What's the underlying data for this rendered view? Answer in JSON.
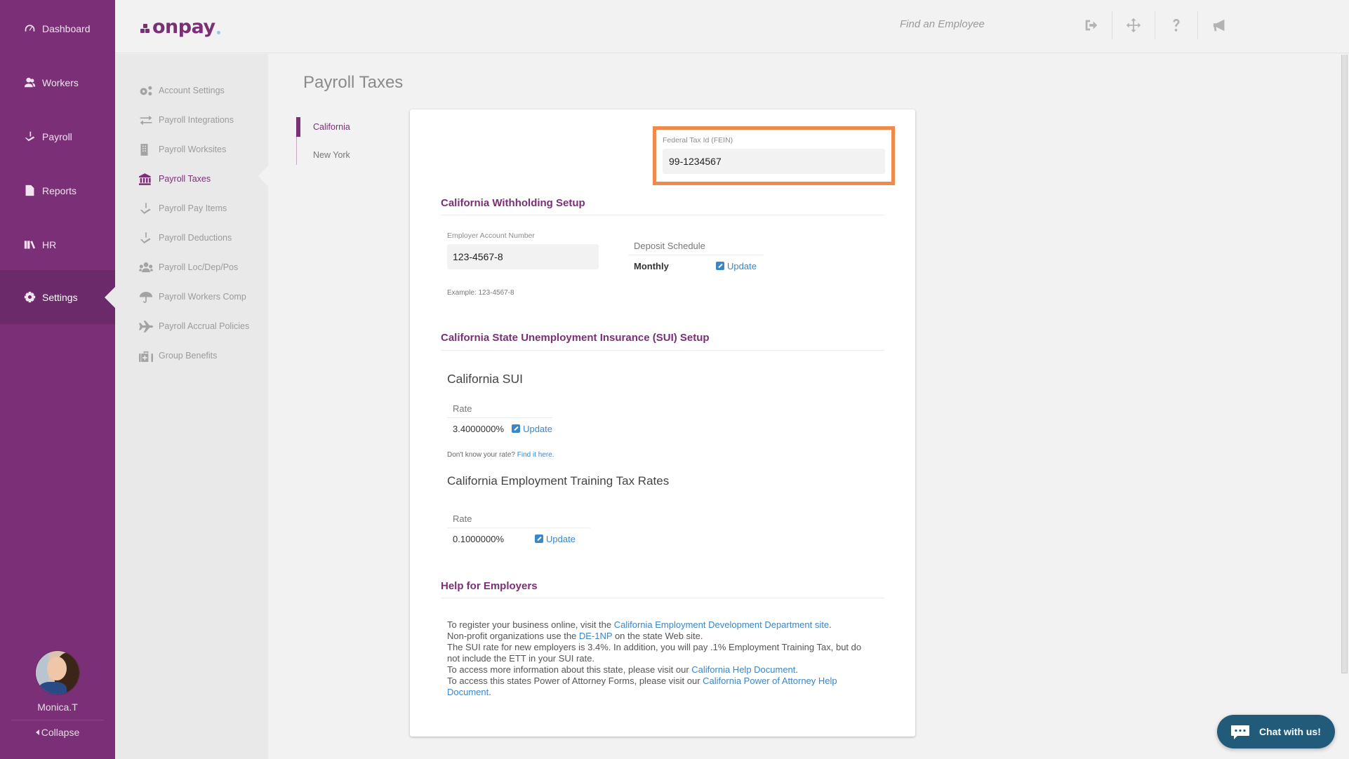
{
  "app": {
    "brand": "onpay",
    "title": "Payroll Taxes"
  },
  "sidebar": {
    "items": [
      {
        "label": "Dashboard",
        "icon": "gauge-icon"
      },
      {
        "label": "Workers",
        "icon": "users-icon"
      },
      {
        "label": "Payroll",
        "icon": "hand-money-icon"
      },
      {
        "label": "Reports",
        "icon": "report-icon"
      },
      {
        "label": "HR",
        "icon": "books-icon"
      },
      {
        "label": "Settings",
        "icon": "gear-icon",
        "active": true
      }
    ],
    "user": {
      "name": "Monica.T"
    },
    "collapse_label": "Collapse"
  },
  "header": {
    "search": {
      "placeholder": "Find an Employee",
      "value": ""
    },
    "icons": [
      "sign-out-icon",
      "move-icon",
      "help-icon",
      "megaphone-icon"
    ]
  },
  "settings_nav": {
    "items": [
      {
        "label": "Account Settings",
        "icon": "gears-icon"
      },
      {
        "label": "Payroll Integrations",
        "icon": "exchange-icon"
      },
      {
        "label": "Payroll Worksites",
        "icon": "building-icon"
      },
      {
        "label": "Payroll Taxes",
        "icon": "bank-icon",
        "active": true
      },
      {
        "label": "Payroll Pay Items",
        "icon": "hand-money-icon"
      },
      {
        "label": "Payroll Deductions",
        "icon": "hand-money-icon"
      },
      {
        "label": "Payroll Loc/Dep/Pos",
        "icon": "group-icon"
      },
      {
        "label": "Payroll Workers Comp",
        "icon": "umbrella-icon"
      },
      {
        "label": "Payroll Accrual Policies",
        "icon": "plane-icon"
      },
      {
        "label": "Group Benefits",
        "icon": "medkit-icon"
      }
    ]
  },
  "page": {
    "title": "Payroll Taxes",
    "state_tabs": [
      {
        "label": "California",
        "active": true
      },
      {
        "label": "New York",
        "active": false
      }
    ]
  },
  "card": {
    "fein": {
      "label": "Federal Tax Id (FEIN)",
      "value": "99-1234567"
    },
    "withholding": {
      "heading": "California Withholding Setup",
      "account_label": "Employer Account Number",
      "account_value": "123-4567-8",
      "account_example": "Example: 123-4567-8",
      "deposit": {
        "header": "Deposit Schedule",
        "value": "Monthly",
        "action": "Update"
      }
    },
    "sui_section": {
      "heading": "California State Unemployment Insurance (SUI) Setup",
      "sui": {
        "title": "California SUI",
        "rate_header": "Rate",
        "rate_value": "3.4000000%",
        "action": "Update"
      },
      "hint_text": "Don't know your rate?",
      "hint_link": "Find it here.",
      "ett": {
        "title": "California Employment Training Tax Rates",
        "rate_header": "Rate",
        "rate_value": "0.1000000%",
        "action": "Update"
      }
    },
    "help": {
      "heading": "Help for Employers",
      "line1_text": "To register your business online, visit the ",
      "line1_link": "California Employment Development Department site",
      "line2_text": "Non-profit organizations use the ",
      "line2_link": "DE-1NP",
      "line2_after": " on the state Web site.",
      "line3_text": "The SUI rate for new employers is 3.4%. In addition, you will pay .1% Employment Training Tax, but do not include the ETT in your SUI rate.",
      "line4_text": "To access more information about this state, please visit our ",
      "line4_link": "California Help Document",
      "line5_text": "To access this states Power of Attorney Forms, please visit our ",
      "line5_link": "California Power of Attorney Help Document"
    }
  },
  "chat": {
    "label": "Chat with us!"
  },
  "colors": {
    "brand_purple": "#7a2f77",
    "highlight_orange": "#ef8a4c",
    "link_blue": "#3a86c8",
    "chat_blue": "#225a7a"
  }
}
